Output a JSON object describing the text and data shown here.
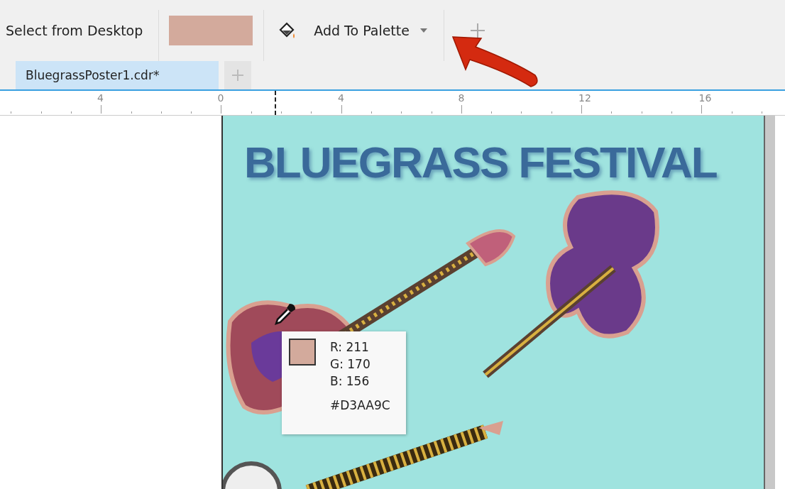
{
  "toolbar": {
    "select_label": "Select from Desktop",
    "swatch": {
      "color": "#d3aa9c"
    },
    "add_button": {
      "label": "Add To Palette"
    }
  },
  "document_tabs": [
    {
      "label": "BluegrassPoster1.cdr*",
      "selected": true
    }
  ],
  "ruler": {
    "labels": [
      "4",
      "0",
      "4",
      "8",
      "12",
      "16"
    ]
  },
  "poster": {
    "title": "BLUEGRASS FESTIVAL"
  },
  "color_tooltip": {
    "color": "#d3aa9c",
    "r": "R: 211",
    "g": "G: 170",
    "b": "B: 156",
    "hex": "#D3AA9C"
  }
}
